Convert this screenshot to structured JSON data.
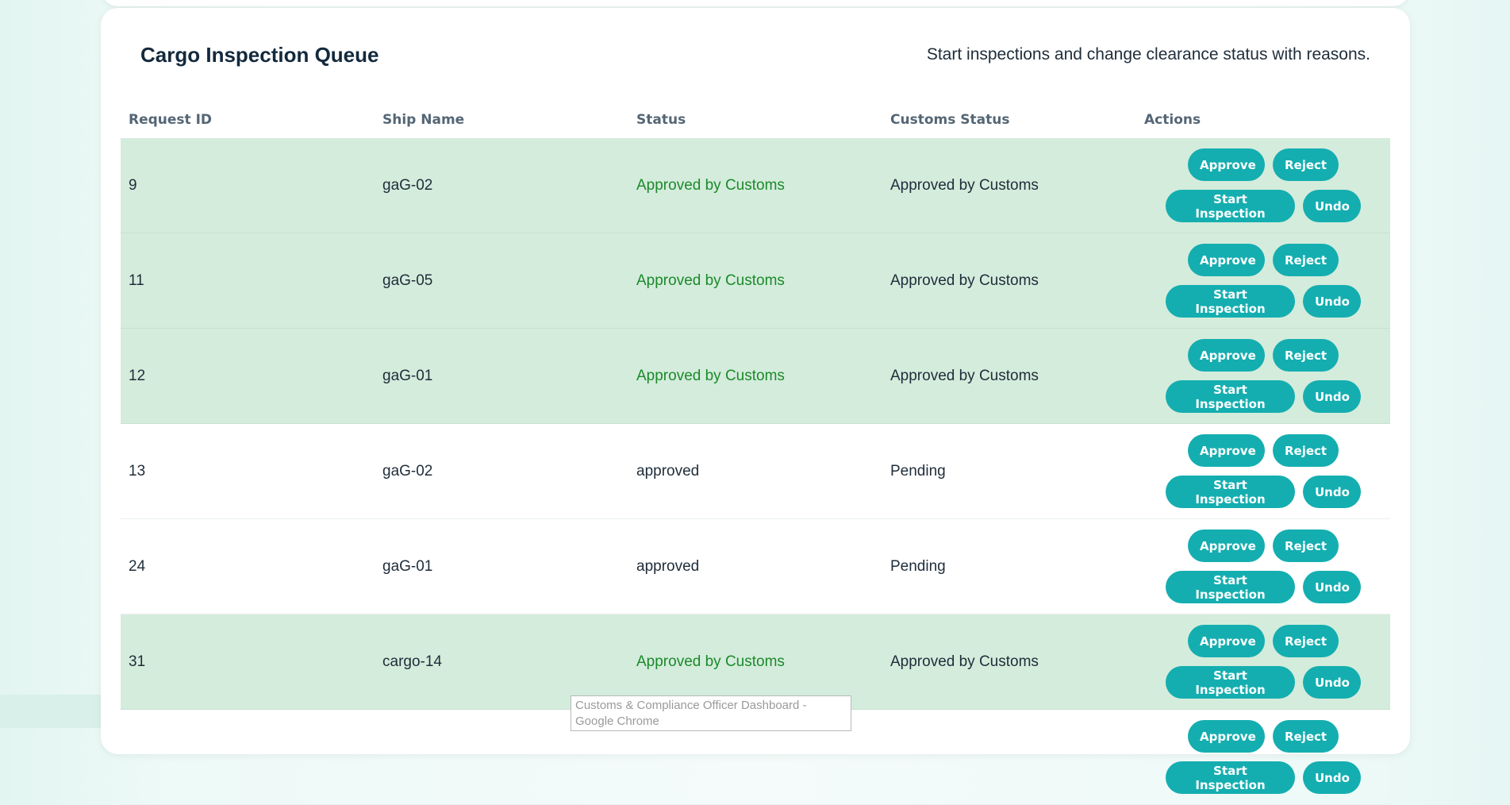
{
  "page": {
    "title": "Cargo Inspection Queue",
    "subtitle": "Start inspections and change clearance status with reasons."
  },
  "table": {
    "columns": [
      "Request ID",
      "Ship Name",
      "Status",
      "Customs Status",
      "Actions"
    ],
    "rows": [
      {
        "id": "9",
        "ship": "gaG-02",
        "status": "Approved by Customs",
        "customs": "Approved by Customs"
      },
      {
        "id": "11",
        "ship": "gaG-05",
        "status": "Approved by Customs",
        "customs": "Approved by Customs"
      },
      {
        "id": "12",
        "ship": "gaG-01",
        "status": "Approved by Customs",
        "customs": "Approved by Customs"
      },
      {
        "id": "13",
        "ship": "gaG-02",
        "status": "approved",
        "customs": "Pending"
      },
      {
        "id": "24",
        "ship": "gaG-01",
        "status": "approved",
        "customs": "Pending"
      },
      {
        "id": "31",
        "ship": "cargo-14",
        "status": "Approved by Customs",
        "customs": "Approved by Customs"
      },
      {
        "id": "",
        "ship": "",
        "status": "",
        "customs": ""
      }
    ],
    "actions": {
      "approve": "Approve",
      "reject": "Reject",
      "start_inspection": "Start Inspection",
      "undo": "Undo"
    }
  },
  "tooltip": {
    "text": "Customs & Compliance Officer Dashboard - Google Chrome"
  },
  "colors": {
    "accent": "#14aeb0",
    "approved_row_bg": "#d4ecdc",
    "approved_text": "#1b8a2a",
    "header_text": "#546675"
  }
}
